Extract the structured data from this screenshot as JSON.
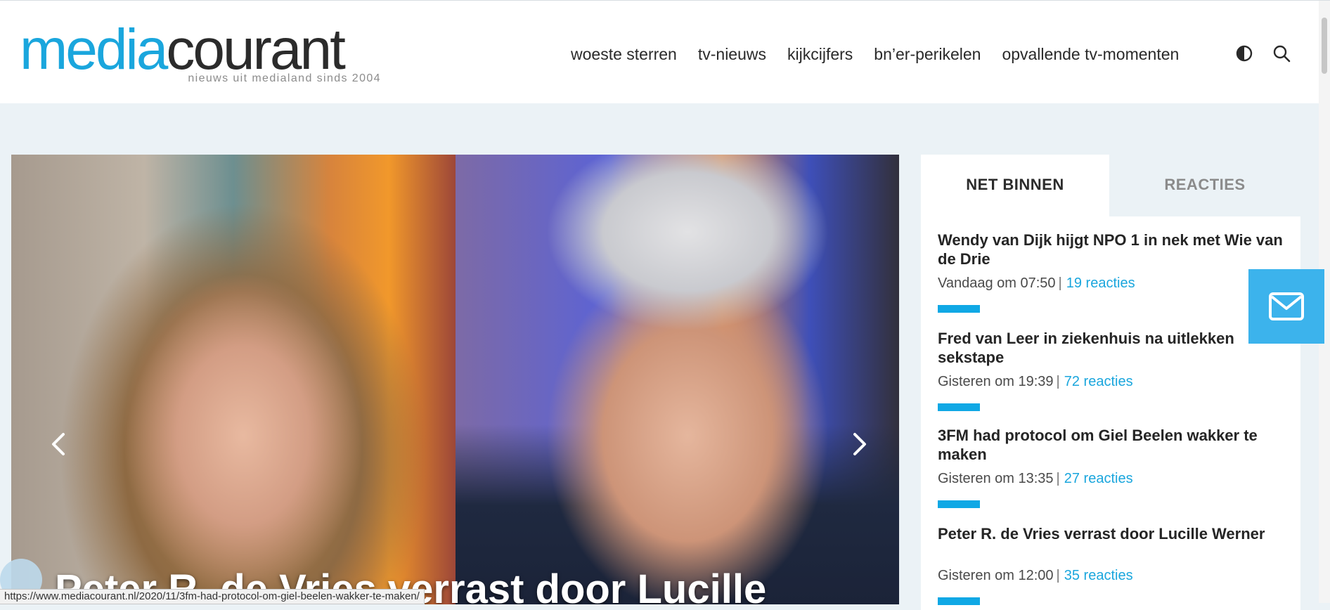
{
  "header": {
    "logo_part1": "media",
    "logo_part2": "courant",
    "tagline": "nieuws uit medialand sinds 2004",
    "nav": [
      "woeste sterren",
      "tv-nieuws",
      "kijkcijfers",
      "bn’er-perikelen",
      "opvallende tv-momenten"
    ],
    "icons": {
      "contrast": "contrast-icon",
      "search": "search-icon"
    }
  },
  "hero": {
    "title": "Peter R. de Vries verrast door Lucille",
    "icons": {
      "prev": "chevron-left-icon",
      "next": "chevron-right-icon"
    }
  },
  "sidebar": {
    "tabs": [
      "NET BINNEN",
      "REACTIES"
    ],
    "items": [
      {
        "title": "Wendy van Dijk hijgt NPO 1 in nek met Wie van de Drie",
        "date": "Vandaag om 07:50",
        "sep": "|",
        "reactions": "19 reacties"
      },
      {
        "title": "Fred van Leer in ziekenhuis na uitlekken sekstape",
        "date": "Gisteren om 19:39",
        "sep": "|",
        "reactions": "72 reacties"
      },
      {
        "title": "3FM had protocol om Giel Beelen wakker te maken",
        "date": "Gisteren om 13:35",
        "sep": "|",
        "reactions": "27 reacties"
      },
      {
        "title": "Peter R. de Vries verrast door Lucille Werner",
        "date": "Gisteren om 12:00",
        "sep": "|",
        "reactions": "35 reacties"
      }
    ]
  },
  "floating": {
    "mail_icon": "mail-icon"
  },
  "status_bar": {
    "url": "https://www.mediacourant.nl/2020/11/3fm-had-protocol-om-giel-beelen-wakker-te-maken/"
  },
  "colors": {
    "brand_blue": "#1aa6dd",
    "accent_bar": "#10a8e5",
    "page_bg": "#ebf2f6",
    "mail_bg": "#3cb3ec"
  }
}
